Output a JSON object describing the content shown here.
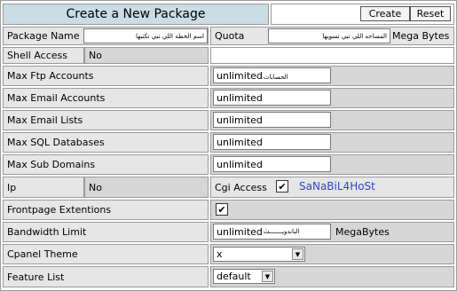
{
  "title": "Create a New Package",
  "buttons": {
    "create": "Create",
    "reset": "Reset"
  },
  "package_name": {
    "label": "Package Name",
    "value": "اسم الخطة اللي تبي تكتبها"
  },
  "quota": {
    "label": "Quota",
    "value": "المساحه اللي تبي تسويها",
    "unit": "Mega Bytes"
  },
  "shell_access": {
    "label": "Shell Access",
    "value": "No"
  },
  "max_ftp": {
    "label": "Max Ftp Accounts",
    "value": "unlimited",
    "note": "الحسابات"
  },
  "max_email": {
    "label": "Max Email Accounts",
    "value": "unlimited"
  },
  "max_lists": {
    "label": "Max Email Lists",
    "value": "unlimited"
  },
  "max_sql": {
    "label": "Max SQL Databases",
    "value": "unlimited"
  },
  "max_subdomains": {
    "label": "Max Sub Domains",
    "value": "unlimited"
  },
  "ip": {
    "label": "Ip",
    "value": "No"
  },
  "cgi": {
    "label": "Cgi Access",
    "checked": true
  },
  "brand": "SaNaBiL4HoSt",
  "frontpage": {
    "label": "Frontpage Extentions",
    "checked": true
  },
  "bandwidth": {
    "label": "Bandwidth Limit",
    "value": "unlimited",
    "note": "الباندويـــــــث",
    "unit": "MegaBytes"
  },
  "cpanel_theme": {
    "label": "Cpanel Theme",
    "selected": "x"
  },
  "feature_list": {
    "label": "Feature List",
    "selected": "default"
  },
  "colors": {
    "header_bg": "#c9dde6",
    "label_bg": "#e6e6e6",
    "grey_bg": "#d6d6d6",
    "brand": "#2b47c9"
  }
}
